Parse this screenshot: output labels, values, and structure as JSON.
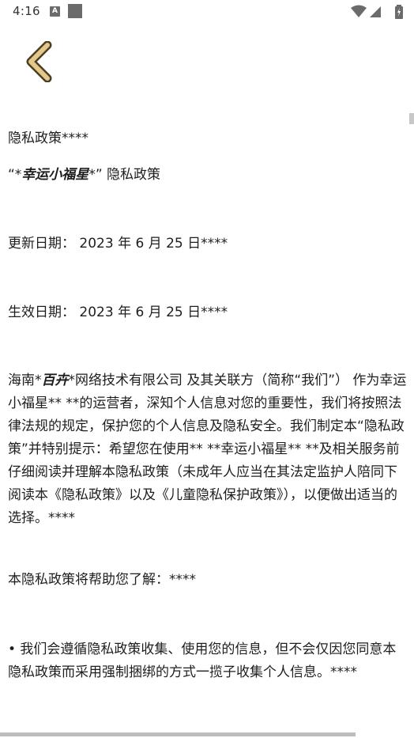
{
  "status_bar": {
    "time": "4:16",
    "notification_letter": "A"
  },
  "nav": {
    "back_icon": "chevron-left-icon"
  },
  "doc": {
    "heading": "隐私政策****",
    "app_title": {
      "open_quote": "“*",
      "app_name": "幸运小福星",
      "close_quote": "*”",
      "suffix": " 隐私政策"
    },
    "update_date": "更新日期： 2023 年 6 月 25 日****",
    "effective_date": "生效日期： 2023 年 6 月 25 日****",
    "intro": {
      "prefix": "海南*",
      "company_emph": "百卉",
      "rest": "*网络技术有限公司 及其关联方（简称“我们”） 作为幸运小福星** **的运营者，深知个人信息对您的重要性，我们将按照法律法规的规定，保护您的个人信息及隐私安全。我们制定本“隐私政策”并特别提示：希望您在使用** **幸运小福星** **及相关服务前仔细阅读并理解本隐私政策（未成年人应当在其法定监护人陪同下阅读本《隐私政策》以及《儿童隐私保护政策》），以便做出适当的选择。****"
    },
    "help_line": "本隐私政策将帮助您了解：****",
    "bullet_1": "• 我们会遵循隐私政策收集、使用您的信息，但不会仅因您同意本隐私政策而采用强制捆绑的方式一揽子收集个人信息。****"
  }
}
